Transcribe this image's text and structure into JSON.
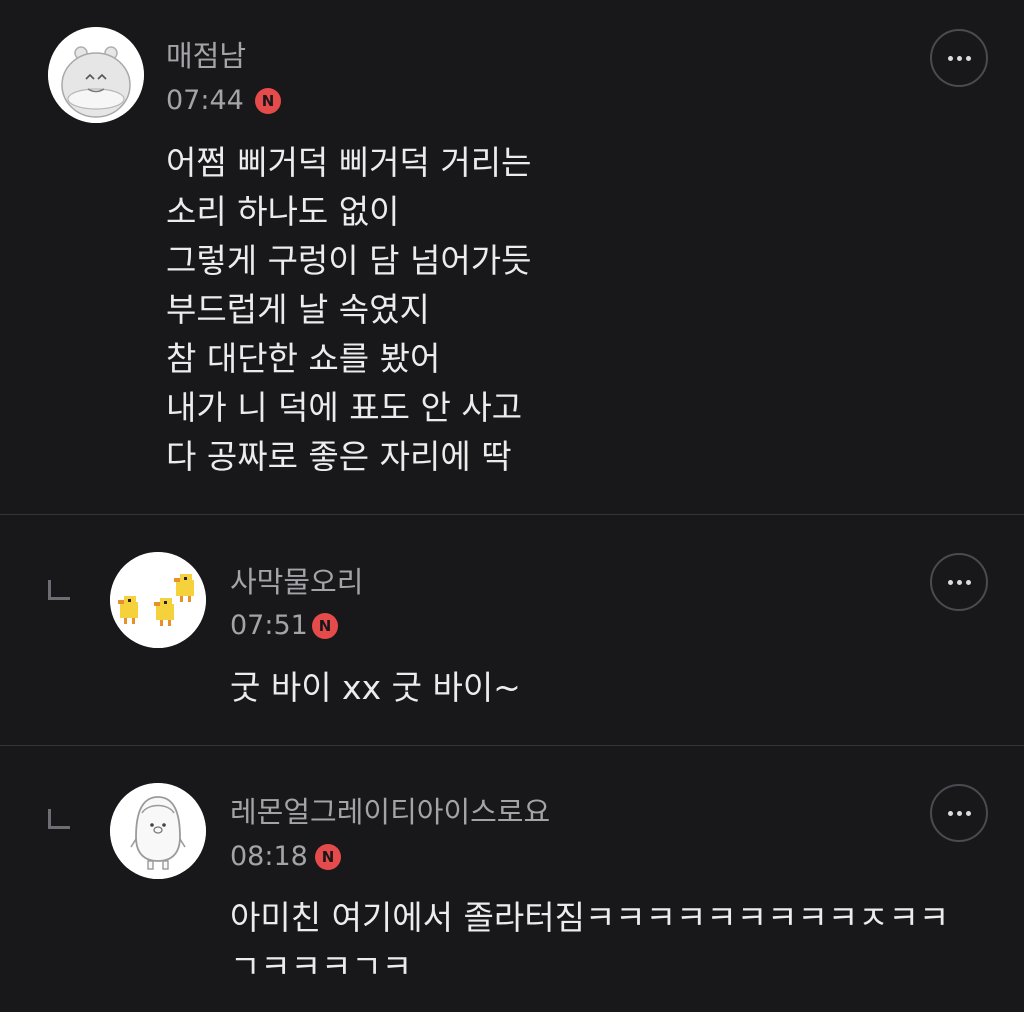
{
  "comments": [
    {
      "nickname": "매점남",
      "time": "07:44",
      "badge": "N",
      "avatar_icon": "hamster-avatar",
      "is_reply": false,
      "lines": [
        "어쩜 삐거덕 삐거덕 거리는",
        "소리 하나도 없이",
        "그렇게 구렁이 담 넘어가듯",
        "부드럽게 날 속였지",
        "참 대단한 쇼를 봤어",
        "내가 니 덕에 표도 안 사고",
        "다 공짜로 좋은 자리에 딱"
      ]
    },
    {
      "nickname": "사막물오리",
      "time": "07:51",
      "badge": "N",
      "avatar_icon": "ducklings-avatar",
      "is_reply": true,
      "lines": [
        "굿 바이 xx 굿 바이~"
      ]
    },
    {
      "nickname": "레몬얼그레이티아이스로요",
      "time": "08:18",
      "badge": "N",
      "avatar_icon": "penguin-avatar",
      "is_reply": true,
      "lines": [
        "아미친 여기에서 졸라터짐ㅋㅋㅋㅋㅋㅋㅋㅋㅋㅈㅋㅋ",
        "ㄱㅋㅋㅋㄱㅋ"
      ]
    }
  ],
  "more_icon": "more-dots-icon",
  "colors": {
    "background": "#18181b",
    "badge": "#e64b4b",
    "meta_text": "#a3a3a8",
    "body_text": "#ececec",
    "divider": "#33333a"
  }
}
